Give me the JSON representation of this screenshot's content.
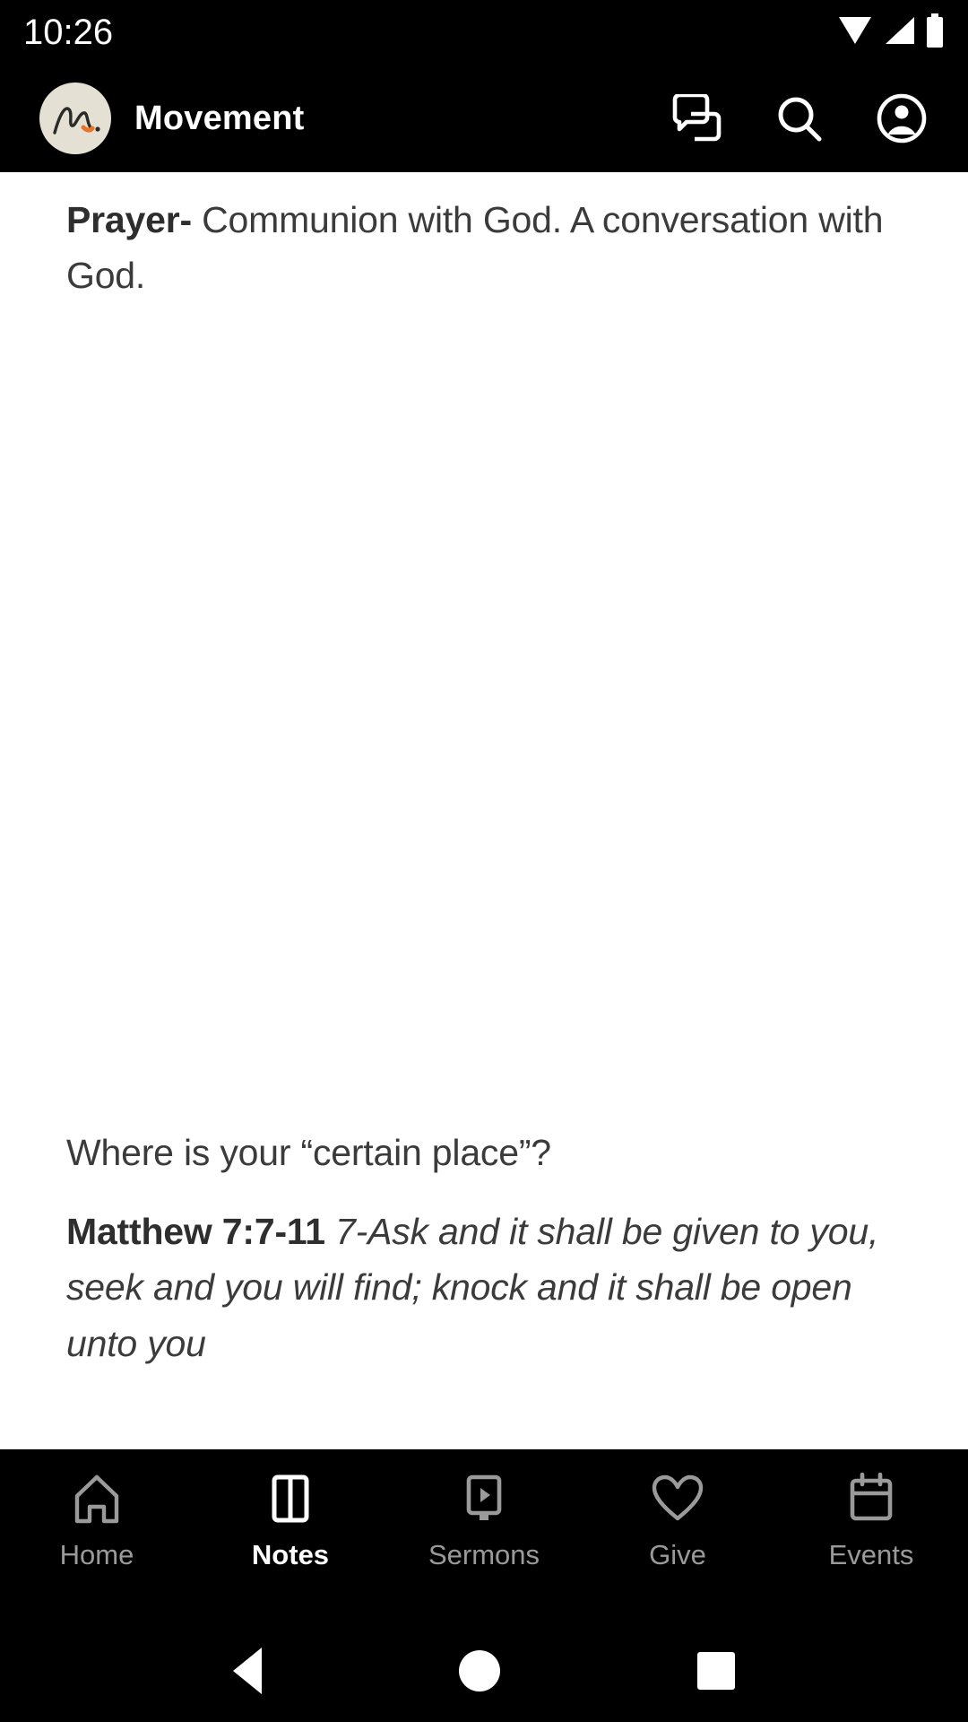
{
  "status_bar": {
    "time": "10:26",
    "icons": [
      "wifi-icon",
      "cellular-signal-icon",
      "battery-icon"
    ]
  },
  "header": {
    "app_title": "Movement",
    "avatar": {
      "name": "movement-logo-avatar",
      "background": "#e4e1d4",
      "mark": "m.",
      "accent": "#e8732a"
    },
    "actions": [
      {
        "name": "messages-icon",
        "label": "Messages"
      },
      {
        "name": "search-icon",
        "label": "Search"
      },
      {
        "name": "account-icon",
        "label": "Account"
      }
    ]
  },
  "notes": {
    "prayer_label": "Prayer-",
    "prayer_body": " Communion with God. A conversation with God.",
    "question": "Where is your “certain place”?",
    "scripture_reference": "Matthew 7:7-11",
    "scripture_text": " 7-Ask and it shall be given to you, seek and you will find; knock and it shall be open unto you"
  },
  "tab_bar": {
    "active": "Notes",
    "items": [
      {
        "label": "Home",
        "icon": "home-icon",
        "active": false
      },
      {
        "label": "Notes",
        "icon": "notes-book-icon",
        "active": true
      },
      {
        "label": "Sermons",
        "icon": "video-play-icon",
        "active": false
      },
      {
        "label": "Give",
        "icon": "heart-icon",
        "active": false
      },
      {
        "label": "Events",
        "icon": "calendar-icon",
        "active": false
      }
    ]
  },
  "system_nav": {
    "back": "back-triangle-icon",
    "home": "home-circle-icon",
    "recents": "recents-square-icon"
  },
  "colors": {
    "bar_background": "#000000",
    "content_background": "#ffffff",
    "text_primary": "#3b3b3b",
    "tab_inactive": "#9a9a9a",
    "tab_active": "#ffffff"
  }
}
